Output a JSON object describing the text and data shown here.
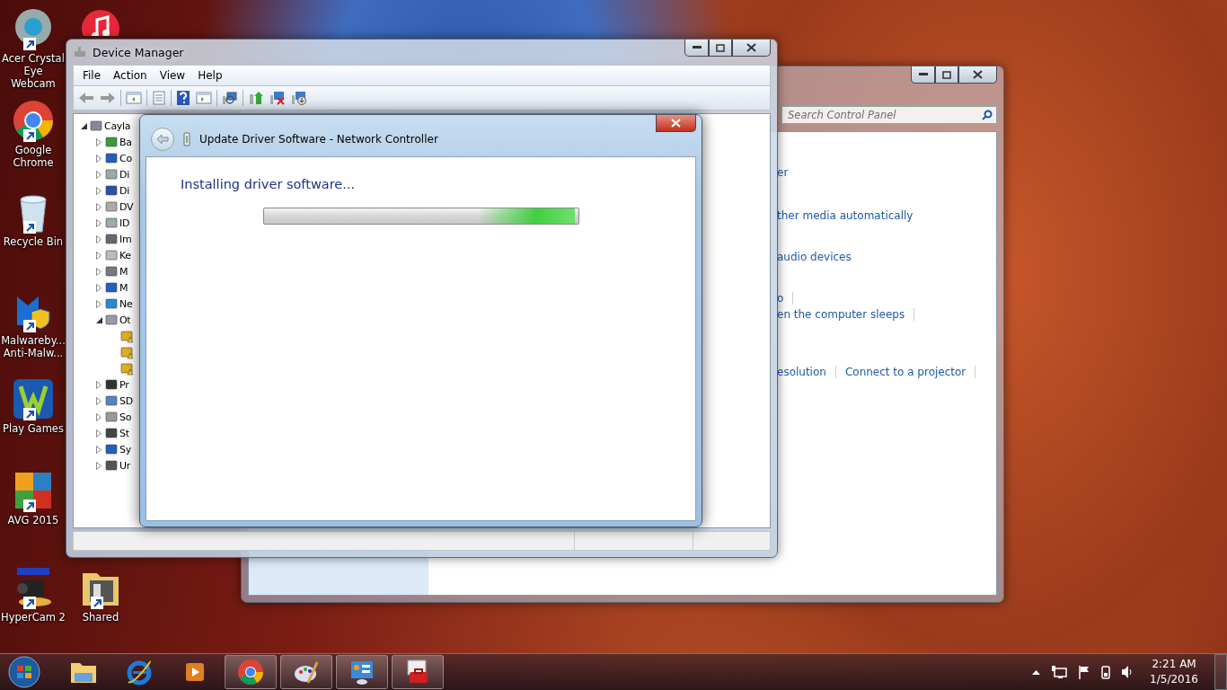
{
  "desktop_icons": [
    {
      "kind": "webcam",
      "label": "Acer Crystal Eye Webcam"
    },
    {
      "kind": "music"
    },
    {
      "kind": "browser",
      "label": "Google Chrome"
    },
    {
      "kind": "recycle",
      "label": "Recycle Bin"
    },
    {
      "kind": "shield",
      "label": "Malwareby... Anti-Malw..."
    },
    {
      "kind": "games",
      "label": "Play Games"
    },
    {
      "kind": "antivirus",
      "label": "AVG 2015"
    },
    {
      "kind": "camcorder",
      "label": "HyperCam 2"
    },
    {
      "kind": "folder",
      "label": "Shared"
    }
  ],
  "control_panel": {
    "search": {
      "placeholder": "Search Control Panel"
    },
    "links": [
      {
        "text": "er",
        "separator": false
      },
      {
        "text": "ther media automatically",
        "separator": false
      },
      {
        "text": "audio devices",
        "separator": false
      },
      {
        "text": "o",
        "separator": true
      },
      {
        "text": "en the computer sleeps",
        "separator": true
      },
      {
        "text": "esolution",
        "separator": true,
        "extra": "Connect to a projector"
      }
    ]
  },
  "device_manager": {
    "title": "Device Manager",
    "menu": [
      "File",
      "Action",
      "View",
      "Help"
    ],
    "tree": [
      {
        "label": "Cayla",
        "kind": "computer",
        "expanded": true,
        "children": [
          {
            "label": "Ba",
            "kind": "battery",
            "expanded": false
          },
          {
            "label": "Co",
            "kind": "monitor",
            "expanded": false
          },
          {
            "label": "Di",
            "kind": "drive",
            "expanded": false
          },
          {
            "label": "Di",
            "kind": "display",
            "expanded": false
          },
          {
            "label": "DV",
            "kind": "dvd",
            "expanded": false
          },
          {
            "label": "ID",
            "kind": "drive",
            "expanded": false
          },
          {
            "label": "Im",
            "kind": "camera",
            "expanded": false
          },
          {
            "label": "Ke",
            "kind": "keyboard",
            "expanded": false
          },
          {
            "label": "M",
            "kind": "mouse",
            "expanded": false
          },
          {
            "label": "M",
            "kind": "monitor",
            "expanded": false
          },
          {
            "label": "Ne",
            "kind": "network",
            "expanded": false
          },
          {
            "label": "Ot",
            "kind": "unknown",
            "expanded": true,
            "children": [
              {
                "kind": "warning"
              },
              {
                "kind": "warning"
              },
              {
                "kind": "warning"
              }
            ]
          },
          {
            "label": "Pr",
            "kind": "processor",
            "expanded": false
          },
          {
            "label": "SD",
            "kind": "card",
            "expanded": false
          },
          {
            "label": "So",
            "kind": "sound",
            "expanded": false
          },
          {
            "label": "St",
            "kind": "storage",
            "expanded": false
          },
          {
            "label": "Sy",
            "kind": "monitor",
            "expanded": false
          },
          {
            "label": "Ur",
            "kind": "usb",
            "expanded": false
          }
        ]
      }
    ]
  },
  "dialog": {
    "title": "Update Driver Software - Network Controller",
    "heading": "Installing driver software...",
    "level": 0.99
  },
  "taskbar": {
    "items": [
      {
        "kind": "explorer",
        "running": false
      },
      {
        "kind": "ie",
        "running": false
      },
      {
        "kind": "media",
        "running": false
      },
      {
        "kind": "chrome",
        "running": true
      },
      {
        "kind": "paint",
        "running": true
      },
      {
        "kind": "control",
        "running": true
      },
      {
        "kind": "toolbox",
        "running": true
      }
    ],
    "time": "2:21 AM",
    "date": "1/5/2016"
  }
}
